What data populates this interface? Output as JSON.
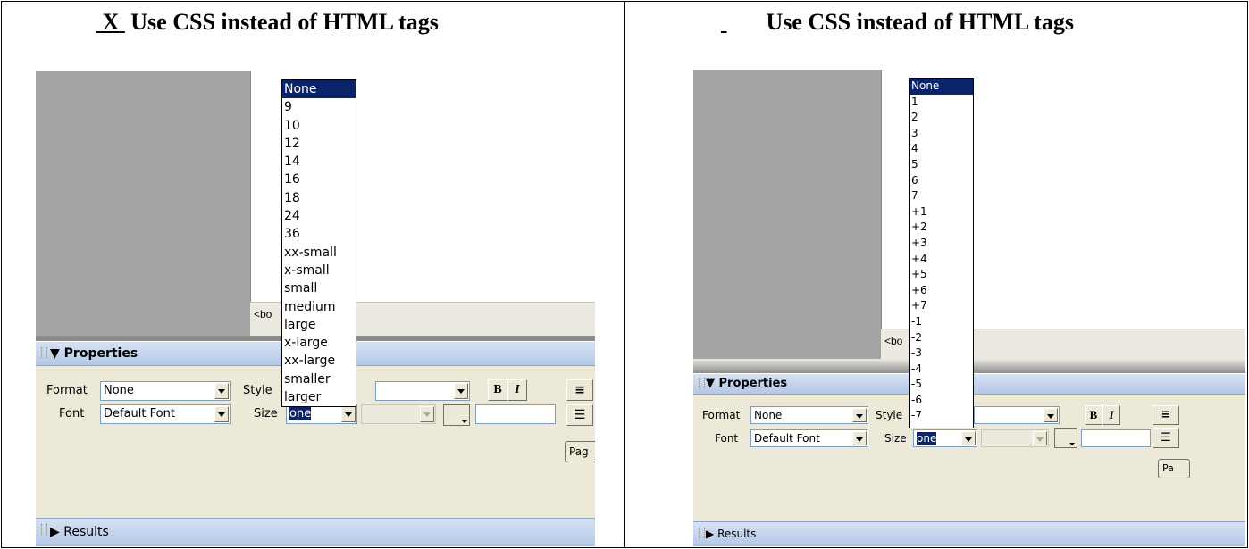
{
  "left": {
    "heading_mark": "X",
    "heading_text": "Use CSS instead of HTML tags",
    "status_text": "<bo",
    "properties_title": "Properties",
    "format_label": "Format",
    "format_value": "None",
    "style_label": "Style",
    "font_label": "Font",
    "font_value": "Default Font",
    "size_label": "Size",
    "size_value": "one",
    "bold_label": "B",
    "italic_label": "I",
    "page_button": "Pag",
    "results_label": "Results",
    "size_options": [
      "None",
      "9",
      "10",
      "12",
      "14",
      "16",
      "18",
      "24",
      "36",
      "xx-small",
      "x-small",
      "small",
      "medium",
      "large",
      "x-large",
      "xx-large",
      "smaller",
      "larger"
    ]
  },
  "right": {
    "heading_mark": "   ",
    "heading_text": "Use CSS instead of HTML tags",
    "status_text": "<bo",
    "properties_title": "Properties",
    "format_label": "Format",
    "format_value": "None",
    "style_label": "Style",
    "font_label": "Font",
    "font_value": "Default Font",
    "size_label": "Size",
    "size_value": "one",
    "bold_label": "B",
    "italic_label": "I",
    "page_button": "Pa",
    "results_label": "Results",
    "size_options": [
      "None",
      "1",
      "2",
      "3",
      "4",
      "5",
      "6",
      "7",
      "+1",
      "+2",
      "+3",
      "+4",
      "+5",
      "+6",
      "+7",
      "-1",
      "-2",
      "-3",
      "-4",
      "-5",
      "-6",
      "-7"
    ]
  },
  "icons": {
    "collapse": "triangle-down-icon",
    "expand": "triangle-right-icon",
    "align": "align-left-icon",
    "list": "unordered-list-icon"
  },
  "colors": {
    "selection": "#0a246a",
    "panel_bg": "#ece9d8",
    "doc_gray": "#a4a4a4"
  }
}
